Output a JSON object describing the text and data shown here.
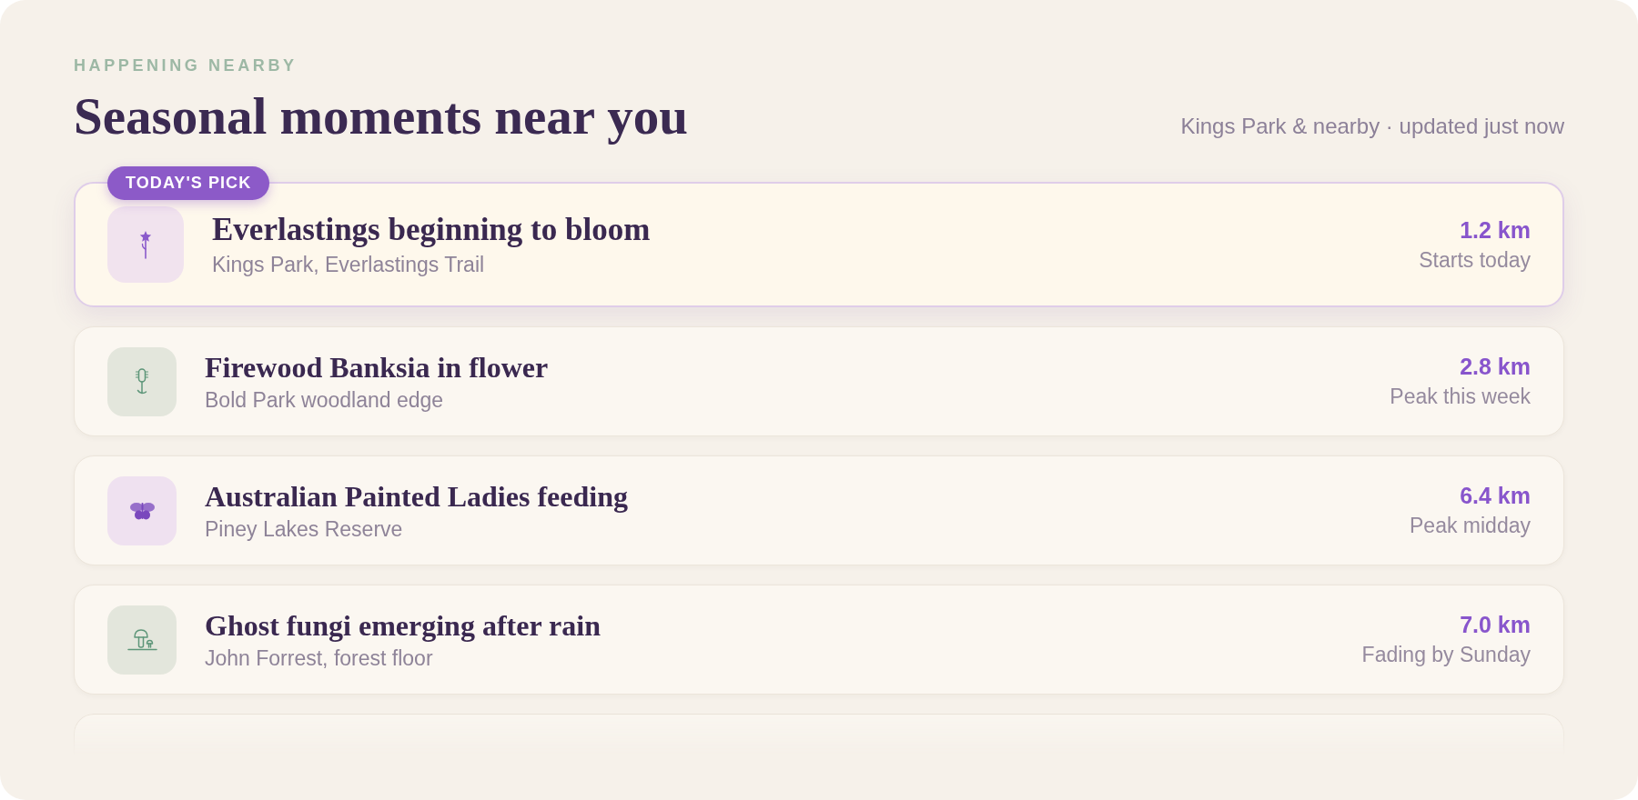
{
  "header": {
    "eyebrow": "HAPPENING NEARBY",
    "title": "Seasonal moments near you",
    "status": "Kings Park & nearby · updated just now"
  },
  "items": [
    {
      "kind": "flower",
      "color": "#f1e3ee",
      "featured": true,
      "badge": "TODAY'S PICK",
      "title": "Everlastings beginning to bloom",
      "location": "Kings Park, Everlastings Trail",
      "distance": "1.2 km",
      "timing": "Starts today"
    },
    {
      "kind": "banksia",
      "color": "#e3e6dc",
      "featured": false,
      "title": "Firewood Banksia in flower",
      "location": "Bold Park woodland edge",
      "distance": "2.8 km",
      "timing": "Peak this week"
    },
    {
      "kind": "butterfly",
      "color": "#efe1f0",
      "featured": false,
      "title": "Australian Painted Ladies feeding",
      "location": "Piney Lakes Reserve",
      "distance": "6.4 km",
      "timing": "Peak midday"
    },
    {
      "kind": "fungi",
      "color": "#e3e6dc",
      "featured": false,
      "title": "Ghost fungi emerging after rain",
      "location": "John Forrest, forest floor",
      "distance": "7.0 km",
      "timing": "Fading by Sunday"
    }
  ]
}
